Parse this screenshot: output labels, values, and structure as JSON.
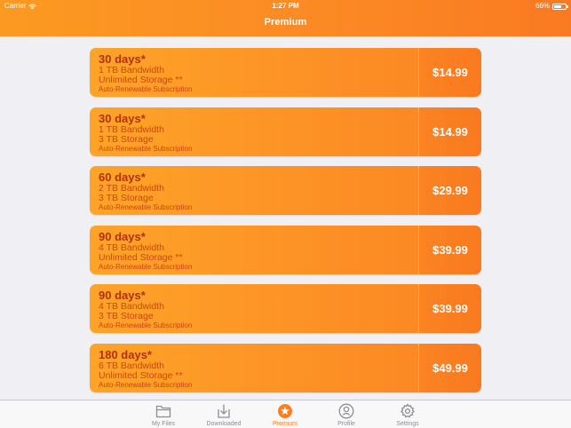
{
  "status_bar": {
    "carrier": "Carrier",
    "time": "1:27 PM",
    "battery": "66%",
    "battery_level": 0.66
  },
  "nav": {
    "title": "Premium"
  },
  "colors": {
    "accent": "#fb8a24",
    "card_text": "#c33a0b",
    "tab_inactive": "#8e8e93",
    "tab_active": "#fb7f22"
  },
  "plans": [
    {
      "duration": "30 days*",
      "line1": "1 TB Bandwidth",
      "line2": "Unlimited Storage **",
      "line3": "Auto-Renewable Subscription",
      "price": "$14.99"
    },
    {
      "duration": "30 days*",
      "line1": "1 TB Bandwidth",
      "line2": "3 TB Storage",
      "line3": "Auto-Renewable Subscription",
      "price": "$14.99"
    },
    {
      "duration": "60 days*",
      "line1": "2 TB Bandwidth",
      "line2": "3 TB Storage",
      "line3": "Auto-Renewable Subscription",
      "price": "$29.99"
    },
    {
      "duration": "90 days*",
      "line1": "4 TB Bandwidth",
      "line2": "Unlimited Storage **",
      "line3": "Auto-Renewable Subscription",
      "price": "$39.99"
    },
    {
      "duration": "90 days*",
      "line1": "4 TB Bandwidth",
      "line2": "3 TB Storage",
      "line3": "Auto-Renewable Subscription",
      "price": "$39.99"
    },
    {
      "duration": "180 days*",
      "line1": "6 TB Bandwidth",
      "line2": "Unlimited Storage **",
      "line3": "Auto-Renewable Subscription",
      "price": "$49.99"
    }
  ],
  "tabs": [
    {
      "label": "My Files",
      "icon": "folder-icon",
      "active": false
    },
    {
      "label": "Downloaded",
      "icon": "download-icon",
      "active": false
    },
    {
      "label": "Premium",
      "icon": "star-icon",
      "active": true
    },
    {
      "label": "Profile",
      "icon": "profile-icon",
      "active": false
    },
    {
      "label": "Settings",
      "icon": "gear-icon",
      "active": false
    }
  ]
}
